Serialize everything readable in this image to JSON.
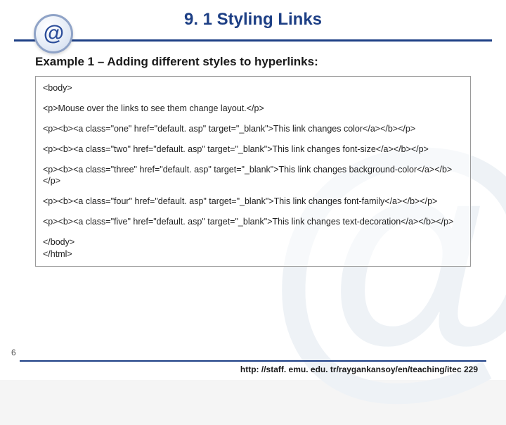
{
  "title": "9. 1 Styling Links",
  "subtitle": "Example 1 – Adding different styles to hyperlinks:",
  "code": {
    "l1": "<body>",
    "l2": "<p>Mouse over the links to see them change layout.</p>",
    "l3": "<p><b><a class=\"one\" href=\"default. asp\" target=\"_blank\">This link changes color</a></b></p>",
    "l4": "<p><b><a class=\"two\" href=\"default. asp\" target=\"_blank\">This link changes font-size</a></b></p>",
    "l5": "<p><b><a class=\"three\" href=\"default. asp\" target=\"_blank\">This link changes background-color</a></b></p>",
    "l6": "<p><b><a class=\"four\" href=\"default. asp\" target=\"_blank\">This link changes font-family</a></b></p>",
    "l7": "<p><b><a class=\"five\" href=\"default. asp\" target=\"_blank\">This link changes text-decoration</a></b></p>",
    "l8": "</body>\n</html>"
  },
  "page_number": "6",
  "footer_url": "http: //staff. emu. edu. tr/raygankansoy/en/teaching/itec 229"
}
